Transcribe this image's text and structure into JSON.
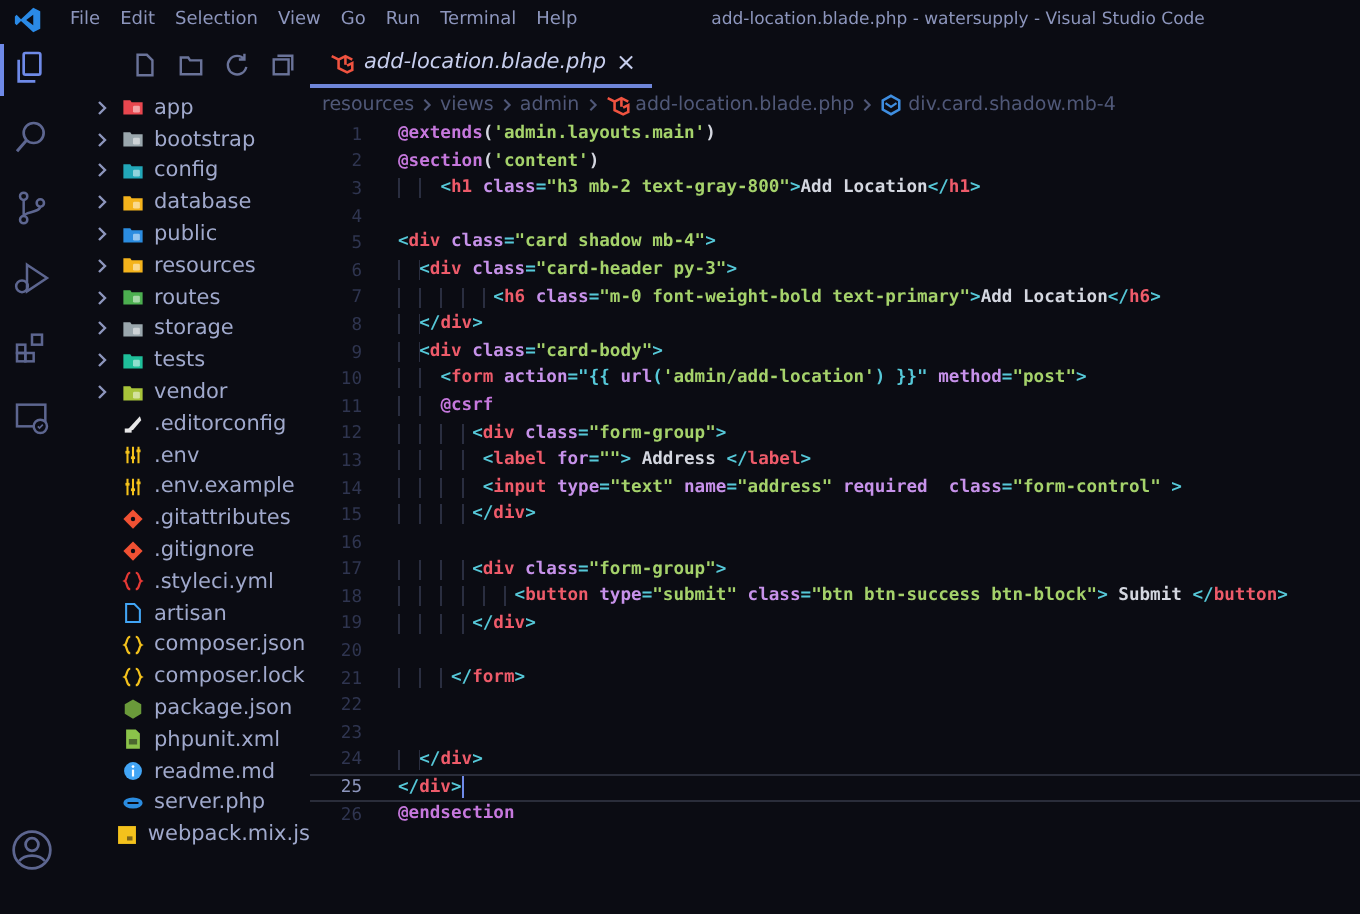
{
  "window": {
    "title": "add-location.blade.php - watersupply - Visual Studio Code"
  },
  "menu": [
    "File",
    "Edit",
    "Selection",
    "View",
    "Go",
    "Run",
    "Terminal",
    "Help"
  ],
  "activity_bar": [
    {
      "kind": "files",
      "selected": true
    },
    {
      "kind": "search",
      "selected": false
    },
    {
      "kind": "branch",
      "selected": false
    },
    {
      "kind": "debug",
      "selected": false
    },
    {
      "kind": "extensions",
      "selected": false
    },
    {
      "kind": "remote",
      "selected": false
    }
  ],
  "explorer": {
    "items": [
      {
        "name": "app",
        "kind": "folder",
        "color": "#e8474f"
      },
      {
        "name": "bootstrap",
        "kind": "folder",
        "color": "#9aa7ad"
      },
      {
        "name": "config",
        "kind": "folder",
        "color": "#22a7b8"
      },
      {
        "name": "database",
        "kind": "folder",
        "color": "#f4b31c"
      },
      {
        "name": "public",
        "kind": "folder",
        "color": "#2b8ce0"
      },
      {
        "name": "resources",
        "kind": "folder",
        "color": "#f4b31c"
      },
      {
        "name": "routes",
        "kind": "folder",
        "color": "#4caf50"
      },
      {
        "name": "storage",
        "kind": "folder",
        "color": "#9aa7ad"
      },
      {
        "name": "tests",
        "kind": "folder",
        "color": "#1fbf9a"
      },
      {
        "name": "vendor",
        "kind": "folder",
        "color": "#a8c43a"
      },
      {
        "name": ".editorconfig",
        "kind": "feather",
        "color": "#e8e8e8"
      },
      {
        "name": ".env",
        "kind": "sliders",
        "color": "#f4c21c"
      },
      {
        "name": ".env.example",
        "kind": "sliders",
        "color": "#f4c21c"
      },
      {
        "name": ".gitattributes",
        "kind": "git",
        "color": "#f05133"
      },
      {
        "name": ".gitignore",
        "kind": "git",
        "color": "#f05133"
      },
      {
        "name": ".styleci.yml",
        "kind": "braces",
        "color": "#e53935"
      },
      {
        "name": "artisan",
        "kind": "file",
        "color": "#42a5f5"
      },
      {
        "name": "composer.json",
        "kind": "braces",
        "color": "#f4c21c"
      },
      {
        "name": "composer.lock",
        "kind": "braces",
        "color": "#f4c21c"
      },
      {
        "name": "package.json",
        "kind": "hexagon",
        "color": "#6a9a3a"
      },
      {
        "name": "phpunit.xml",
        "kind": "sheet",
        "color": "#8bc34a"
      },
      {
        "name": "readme.md",
        "kind": "info",
        "color": "#42a5f5"
      },
      {
        "name": "server.php",
        "kind": "link",
        "color": "#2b8ce0"
      },
      {
        "name": "webpack.mix.js",
        "kind": "square",
        "color": "#f4c21c"
      }
    ]
  },
  "tab": {
    "label": "add-location.blade.php",
    "close": "×",
    "selected": true
  },
  "breadcrumb": [
    {
      "text": "resources",
      "kind": "plain"
    },
    {
      "text": "views",
      "kind": "plain"
    },
    {
      "text": "admin",
      "kind": "plain"
    },
    {
      "text": "add-location.blade.php",
      "kind": "laravel"
    },
    {
      "text": "div.card.shadow.mb-4",
      "kind": "element"
    }
  ],
  "code": [
    {
      "number": "1",
      "current": false,
      "tokens": [
        {
          "kind": "directive",
          "text": "@extends"
        },
        {
          "kind": "text",
          "text": "("
        },
        {
          "kind": "string",
          "text": "'admin.layouts.main'"
        },
        {
          "kind": "text",
          "text": ")"
        }
      ]
    },
    {
      "number": "2",
      "current": false,
      "tokens": [
        {
          "kind": "directive",
          "text": "@section"
        },
        {
          "kind": "text",
          "text": "("
        },
        {
          "kind": "string",
          "text": "'content'"
        },
        {
          "kind": "text",
          "text": ")"
        }
      ]
    },
    {
      "number": "3",
      "current": false,
      "tokens": [
        {
          "kind": "punct",
          "text": "    <"
        },
        {
          "kind": "tag",
          "text": "h1"
        },
        {
          "kind": "attr",
          "text": " class"
        },
        {
          "kind": "punct",
          "text": "="
        },
        {
          "kind": "string",
          "text": "\"h3 mb-2 text-gray-800\""
        },
        {
          "kind": "punct",
          "text": ">"
        },
        {
          "kind": "text",
          "text": "Add Location"
        },
        {
          "kind": "punct",
          "text": "</"
        },
        {
          "kind": "tag",
          "text": "h1"
        },
        {
          "kind": "punct",
          "text": ">"
        }
      ]
    },
    {
      "number": "4",
      "current": false
    },
    {
      "number": "5",
      "current": false,
      "tokens": [
        {
          "kind": "punct",
          "text": "<"
        },
        {
          "kind": "tag",
          "text": "div"
        },
        {
          "kind": "attr",
          "text": " class"
        },
        {
          "kind": "punct",
          "text": "="
        },
        {
          "kind": "string",
          "text": "\"card shadow mb-4\""
        },
        {
          "kind": "punct",
          "text": ">"
        }
      ]
    },
    {
      "number": "6",
      "current": false,
      "tokens": [
        {
          "kind": "punct",
          "text": "  <"
        },
        {
          "kind": "tag",
          "text": "div"
        },
        {
          "kind": "attr",
          "text": " class"
        },
        {
          "kind": "punct",
          "text": "="
        },
        {
          "kind": "string",
          "text": "\"card-header py-3\""
        },
        {
          "kind": "punct",
          "text": ">"
        }
      ]
    },
    {
      "number": "7",
      "current": false,
      "tokens": [
        {
          "kind": "punct",
          "text": "         <"
        },
        {
          "kind": "tag",
          "text": "h6"
        },
        {
          "kind": "attr",
          "text": " class"
        },
        {
          "kind": "punct",
          "text": "="
        },
        {
          "kind": "string",
          "text": "\"m-0 font-weight-bold text-primary\""
        },
        {
          "kind": "punct",
          "text": ">"
        },
        {
          "kind": "text",
          "text": "Add Location"
        },
        {
          "kind": "punct",
          "text": "</"
        },
        {
          "kind": "tag",
          "text": "h6"
        },
        {
          "kind": "punct",
          "text": ">"
        }
      ]
    },
    {
      "number": "8",
      "current": false,
      "tokens": [
        {
          "kind": "punct",
          "text": "  </"
        },
        {
          "kind": "tag",
          "text": "div"
        },
        {
          "kind": "punct",
          "text": ">"
        }
      ]
    },
    {
      "number": "9",
      "current": false,
      "tokens": [
        {
          "kind": "punct",
          "text": "  <"
        },
        {
          "kind": "tag",
          "text": "div"
        },
        {
          "kind": "attr",
          "text": " class"
        },
        {
          "kind": "punct",
          "text": "="
        },
        {
          "kind": "string",
          "text": "\"card-body\""
        },
        {
          "kind": "punct",
          "text": ">"
        }
      ]
    },
    {
      "number": "10",
      "current": false,
      "tokens": [
        {
          "kind": "punct",
          "text": "    <"
        },
        {
          "kind": "tag",
          "text": "form"
        },
        {
          "kind": "attr",
          "text": " action"
        },
        {
          "kind": "punct",
          "text": "=\"{{ "
        },
        {
          "kind": "attr",
          "text": "url"
        },
        {
          "kind": "punct",
          "text": "("
        },
        {
          "kind": "string",
          "text": "'admin/add-location'"
        },
        {
          "kind": "punct",
          "text": ") }}\""
        },
        {
          "kind": "attr",
          "text": " method"
        },
        {
          "kind": "punct",
          "text": "="
        },
        {
          "kind": "string",
          "text": "\"post\""
        },
        {
          "kind": "punct",
          "text": ">"
        }
      ]
    },
    {
      "number": "11",
      "current": false,
      "tokens": [
        {
          "kind": "directive",
          "text": "    @csrf"
        }
      ]
    },
    {
      "number": "12",
      "current": false,
      "tokens": [
        {
          "kind": "punct",
          "text": "       <"
        },
        {
          "kind": "tag",
          "text": "div"
        },
        {
          "kind": "attr",
          "text": " class"
        },
        {
          "kind": "punct",
          "text": "="
        },
        {
          "kind": "string",
          "text": "\"form-group\""
        },
        {
          "kind": "punct",
          "text": ">"
        }
      ]
    },
    {
      "number": "13",
      "current": false,
      "tokens": [
        {
          "kind": "punct",
          "text": "        <"
        },
        {
          "kind": "tag",
          "text": "label"
        },
        {
          "kind": "attr",
          "text": " for"
        },
        {
          "kind": "punct",
          "text": "="
        },
        {
          "kind": "string",
          "text": "\"\""
        },
        {
          "kind": "punct",
          "text": ">"
        },
        {
          "kind": "text",
          "text": " Address "
        },
        {
          "kind": "punct",
          "text": "</"
        },
        {
          "kind": "tag",
          "text": "label"
        },
        {
          "kind": "punct",
          "text": ">"
        }
      ]
    },
    {
      "number": "14",
      "current": false,
      "tokens": [
        {
          "kind": "punct",
          "text": "        <"
        },
        {
          "kind": "tag",
          "text": "input"
        },
        {
          "kind": "attr",
          "text": " type"
        },
        {
          "kind": "punct",
          "text": "="
        },
        {
          "kind": "string",
          "text": "\"text\""
        },
        {
          "kind": "attr",
          "text": " name"
        },
        {
          "kind": "punct",
          "text": "="
        },
        {
          "kind": "string",
          "text": "\"address\""
        },
        {
          "kind": "attr",
          "text": " required  class"
        },
        {
          "kind": "punct",
          "text": "="
        },
        {
          "kind": "string",
          "text": "\"form-control\""
        },
        {
          "kind": "punct",
          "text": " >"
        }
      ]
    },
    {
      "number": "15",
      "current": false,
      "tokens": [
        {
          "kind": "punct",
          "text": "       </"
        },
        {
          "kind": "tag",
          "text": "div"
        },
        {
          "kind": "punct",
          "text": ">"
        }
      ]
    },
    {
      "number": "16",
      "current": false
    },
    {
      "number": "17",
      "current": false,
      "tokens": [
        {
          "kind": "punct",
          "text": "       <"
        },
        {
          "kind": "tag",
          "text": "div"
        },
        {
          "kind": "attr",
          "text": " class"
        },
        {
          "kind": "punct",
          "text": "="
        },
        {
          "kind": "string",
          "text": "\"form-group\""
        },
        {
          "kind": "punct",
          "text": ">"
        }
      ]
    },
    {
      "number": "18",
      "current": false,
      "tokens": [
        {
          "kind": "punct",
          "text": "           <"
        },
        {
          "kind": "tag",
          "text": "button"
        },
        {
          "kind": "attr",
          "text": " type"
        },
        {
          "kind": "punct",
          "text": "="
        },
        {
          "kind": "string",
          "text": "\"submit\""
        },
        {
          "kind": "attr",
          "text": " class"
        },
        {
          "kind": "punct",
          "text": "="
        },
        {
          "kind": "string",
          "text": "\"btn btn-success btn-block\""
        },
        {
          "kind": "punct",
          "text": ">"
        },
        {
          "kind": "text",
          "text": " Submit "
        },
        {
          "kind": "punct",
          "text": "</"
        },
        {
          "kind": "tag",
          "text": "button"
        },
        {
          "kind": "punct",
          "text": ">"
        }
      ]
    },
    {
      "number": "19",
      "current": false,
      "tokens": [
        {
          "kind": "punct",
          "text": "       </"
        },
        {
          "kind": "tag",
          "text": "div"
        },
        {
          "kind": "punct",
          "text": ">"
        }
      ]
    },
    {
      "number": "20",
      "current": false
    },
    {
      "number": "21",
      "current": false,
      "tokens": [
        {
          "kind": "punct",
          "text": "     </"
        },
        {
          "kind": "tag",
          "text": "form"
        },
        {
          "kind": "punct",
          "text": ">"
        }
      ]
    },
    {
      "number": "22",
      "current": false
    },
    {
      "number": "23",
      "current": false
    },
    {
      "number": "24",
      "current": false,
      "tokens": [
        {
          "kind": "punct",
          "text": "  </"
        },
        {
          "kind": "tag",
          "text": "div"
        },
        {
          "kind": "punct",
          "text": ">"
        }
      ]
    },
    {
      "number": "25",
      "current": true,
      "tokens": [
        {
          "kind": "punct",
          "text": "</"
        },
        {
          "kind": "tag",
          "text": "div"
        },
        {
          "kind": "punct",
          "text": ">"
        }
      ]
    },
    {
      "number": "26",
      "current": false,
      "tokens": [
        {
          "kind": "directive",
          "text": "@endsection"
        }
      ]
    }
  ]
}
